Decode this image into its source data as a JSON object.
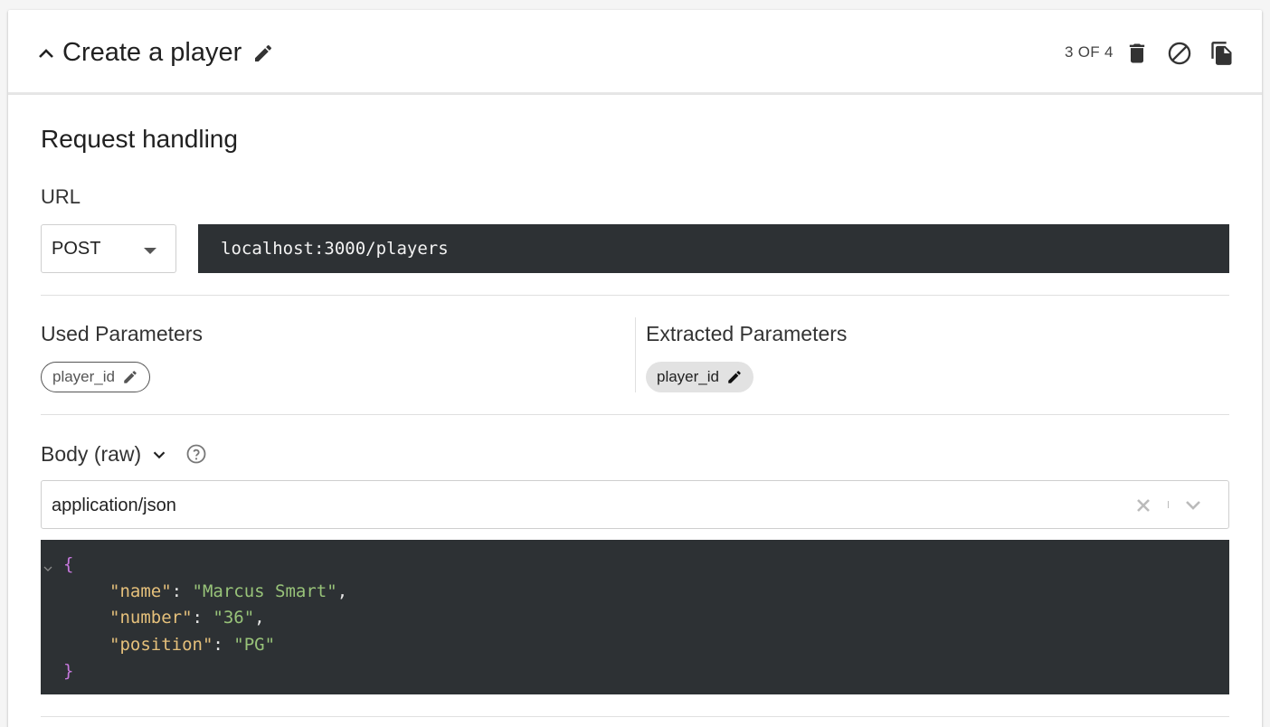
{
  "header": {
    "title": "Create a player",
    "counter": "3 OF 4",
    "icons": [
      "chevron-up-icon",
      "pencil-icon",
      "trash-icon",
      "block-icon",
      "copy-icon"
    ]
  },
  "request": {
    "section_title": "Request handling",
    "url_label": "URL",
    "method": "POST",
    "url": "localhost:3000/players"
  },
  "parameters": {
    "used_title": "Used Parameters",
    "used": [
      "player_id"
    ],
    "extracted_title": "Extracted Parameters",
    "extracted": [
      "player_id"
    ]
  },
  "body": {
    "label": "Body (raw)",
    "content_type": "application/json",
    "code": {
      "open_brace": "{",
      "close_brace": "}",
      "entries": [
        {
          "key": "\"name\"",
          "value": "\"Marcus Smart\"",
          "trailing": ","
        },
        {
          "key": "\"number\"",
          "value": "\"36\"",
          "trailing": ","
        },
        {
          "key": "\"position\"",
          "value": "\"PG\"",
          "trailing": ""
        }
      ]
    }
  },
  "colors": {
    "editor_bg": "#2d3134",
    "json_brace": "#c678dd",
    "json_key": "#e5c07b",
    "json_string": "#98c379"
  }
}
